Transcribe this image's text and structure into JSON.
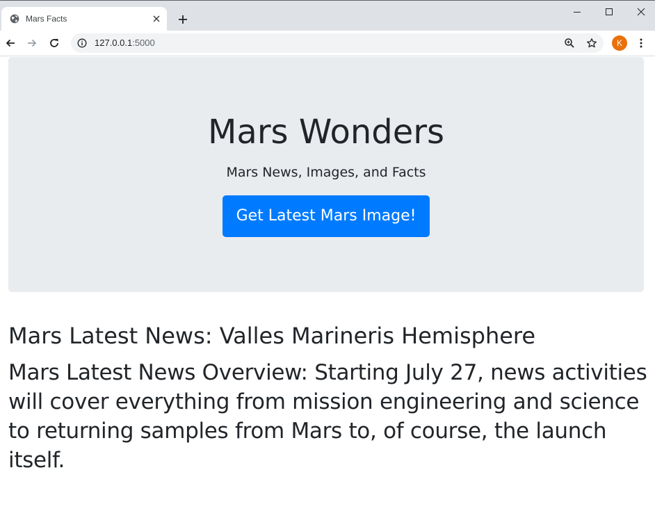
{
  "browser": {
    "tab_title": "Mars Facts",
    "url_host": "127.0.0.1",
    "url_port": ":5000",
    "profile_initial": "K",
    "profile_color": "#e8710a"
  },
  "page": {
    "title": "Mars Wonders",
    "subtitle": "Mars News, Images, and Facts",
    "button_label": "Get Latest Mars Image!",
    "news_title": "Mars Latest News: Valles Marineris Hemisphere",
    "news_overview": "Mars Latest News Overview: Starting July 27, news activities will cover everything from mission engineering and science to returning samples from Mars to, of course, the launch itself."
  },
  "colors": {
    "jumbotron_bg": "#e9ecef",
    "button_bg": "#007bff",
    "text": "#212529"
  },
  "icons": {
    "favicon": "globe-icon",
    "tab_close": "close-icon",
    "new_tab": "plus-icon",
    "minimize": "minimize-icon",
    "maximize": "maximize-icon",
    "close_window": "close-window-icon",
    "back": "back-arrow-icon",
    "forward": "forward-arrow-icon",
    "reload": "reload-icon",
    "site_info": "info-icon",
    "zoom": "zoom-icon",
    "bookmark": "star-icon",
    "menu": "kebab-menu-icon"
  }
}
